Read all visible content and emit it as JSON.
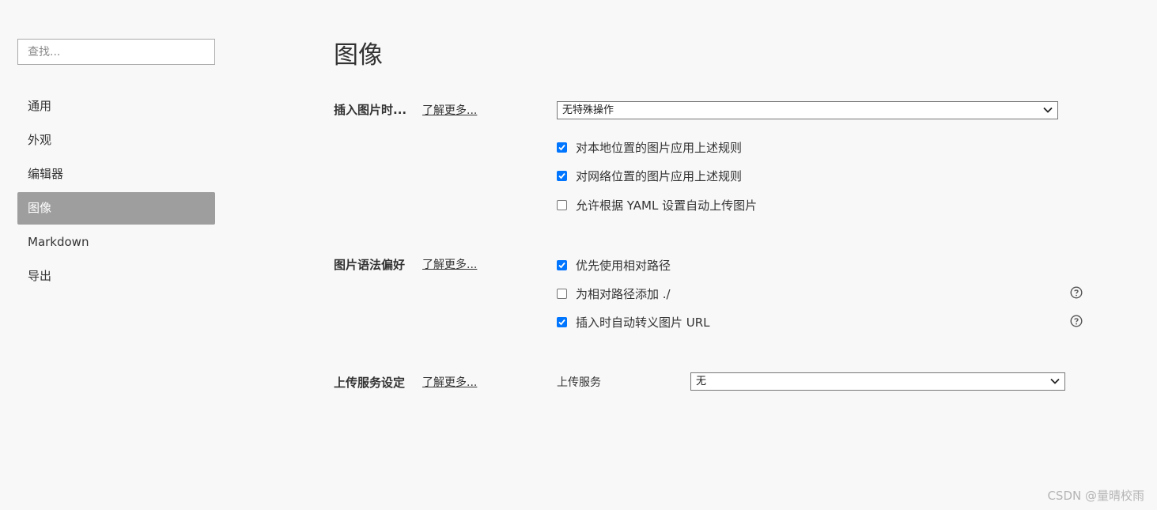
{
  "sidebar": {
    "search_placeholder": "查找...",
    "items": [
      {
        "label": "通用",
        "active": false
      },
      {
        "label": "外观",
        "active": false
      },
      {
        "label": "编辑器",
        "active": false
      },
      {
        "label": "图像",
        "active": true
      },
      {
        "label": "Markdown",
        "active": false
      },
      {
        "label": "导出",
        "active": false
      }
    ]
  },
  "main": {
    "title": "图像",
    "sections": {
      "insert": {
        "label": "插入图片时...",
        "learn_more": "了解更多...",
        "select_value": "无特殊操作",
        "options": [
          {
            "label": "对本地位置的图片应用上述规则",
            "checked": true
          },
          {
            "label": "对网络位置的图片应用上述规则",
            "checked": true
          },
          {
            "label": "允许根据 YAML 设置自动上传图片",
            "checked": false
          }
        ]
      },
      "syntax": {
        "label": "图片语法偏好",
        "learn_more": "了解更多...",
        "options": [
          {
            "label": "优先使用相对路径",
            "checked": true,
            "help": false
          },
          {
            "label": "为相对路径添加 ./",
            "checked": false,
            "help": true
          },
          {
            "label": "插入时自动转义图片 URL",
            "checked": true,
            "help": true
          }
        ]
      },
      "upload": {
        "label": "上传服务设定",
        "learn_more": "了解更多...",
        "field_label": "上传服务",
        "select_value": "无"
      }
    }
  },
  "watermark": "CSDN @量晴校雨",
  "colors": {
    "accent": "#0075ff",
    "active_nav_bg": "#9e9e9e",
    "background": "#f8f8f8"
  }
}
